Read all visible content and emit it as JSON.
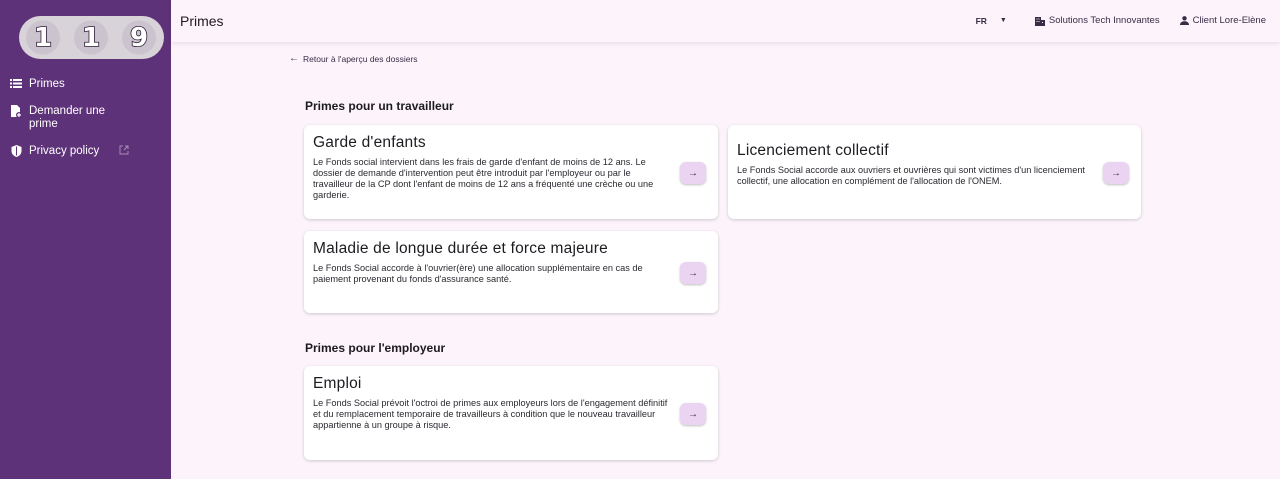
{
  "logo": {
    "digits": [
      "1",
      "1",
      "9"
    ]
  },
  "sidebar": {
    "items": [
      {
        "label": "Primes",
        "icon": "list-icon"
      },
      {
        "label": "Demander une prime",
        "icon": "file-add-icon"
      },
      {
        "label": "Privacy policy",
        "icon": "shield-icon",
        "external": "external-link-icon"
      }
    ]
  },
  "header": {
    "title": "Primes",
    "language": "FR",
    "company": "Solutions Tech Innovantes",
    "user": "Client Lore-Elène"
  },
  "main": {
    "back_link": "Retour à l'aperçu des dossiers",
    "sections": [
      {
        "title": "Primes pour un travailleur",
        "cards": [
          {
            "title": "Garde d'enfants",
            "description": "Le Fonds social intervient dans les frais de garde d'enfant de moins de 12 ans. Le dossier de demande d'intervention peut être introduit par l'employeur ou par le travailleur de la CP dont l'enfant de moins de 12 ans a fréquenté une crèche ou une garderie."
          },
          {
            "title": "Licenciement collectif",
            "description": "Le Fonds Social accorde aux ouvriers et ouvrières qui sont victimes d'un licenciement collectif, une allocation en complément de l'allocation de l'ONEM."
          },
          {
            "title": "Maladie de longue durée et force majeure",
            "description": "Le Fonds Social accorde à l'ouvrier(ère) une allocation supplémentaire en cas de paiement provenant du fonds d'assurance santé."
          }
        ]
      },
      {
        "title": "Primes pour l'employeur",
        "cards": [
          {
            "title": "Emploi",
            "description": "Le Fonds Social prévoit l'octroi de primes aux employeurs lors de l'engagement définitif et du remplacement temporaire de travailleurs à condition que le nouveau travailleur appartienne à un groupe à risque."
          }
        ]
      }
    ]
  },
  "colors": {
    "sidebar": "#5e3278",
    "background": "#fcf3fb",
    "button": "#ead4f2"
  }
}
